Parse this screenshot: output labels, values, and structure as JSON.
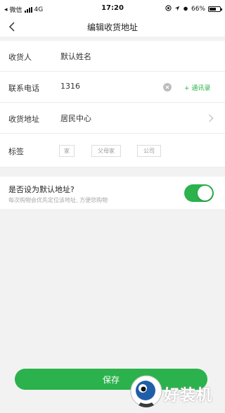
{
  "status_bar": {
    "carrier": "微信",
    "network": "4G",
    "time": "17:20",
    "battery": "66%",
    "battery_level": 0.66
  },
  "nav": {
    "title": "编辑收货地址",
    "back_icon": "chevron-left-icon"
  },
  "form": {
    "receiver": {
      "label": "收货人",
      "value": "默认姓名"
    },
    "phone": {
      "label": "联系电话",
      "value": "1316",
      "contacts_link": "+ 通讯录"
    },
    "address": {
      "label": "收货地址",
      "value": "居民中心"
    },
    "tags": {
      "label": "标签",
      "options": [
        "家",
        "父母家",
        "公司"
      ]
    }
  },
  "default_address": {
    "title": "是否设为默认地址?",
    "subtitle": "每次购物会优先定位该地址, 方便您购物",
    "enabled": true
  },
  "save_label": "保存",
  "watermark": "好装机",
  "colors": {
    "accent": "#2bb24c",
    "background": "#f2f2f2"
  }
}
